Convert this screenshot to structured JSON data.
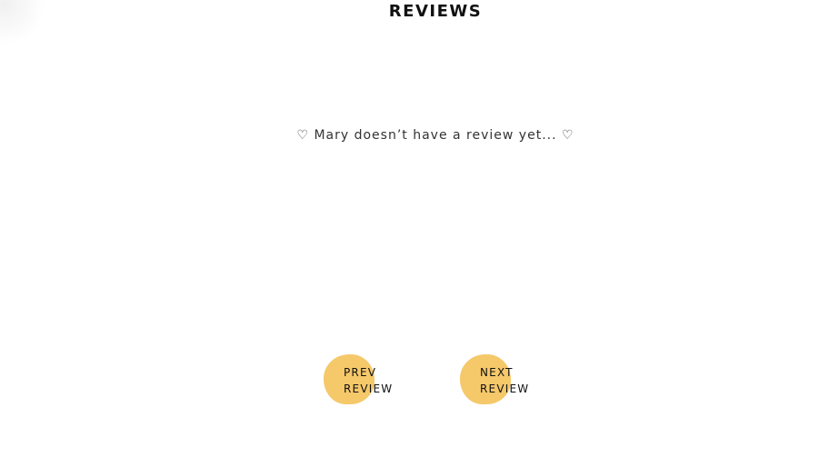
{
  "section": {
    "title": "REVIEWS",
    "empty_message": "♡ Mary doesn’t have a review yet... ♡"
  },
  "controls": {
    "prev_label": "PREV\nREVIEW",
    "next_label": "NEXT\nREVIEW"
  },
  "colors": {
    "button_bg": "#f5c86a",
    "text": "#111111"
  }
}
